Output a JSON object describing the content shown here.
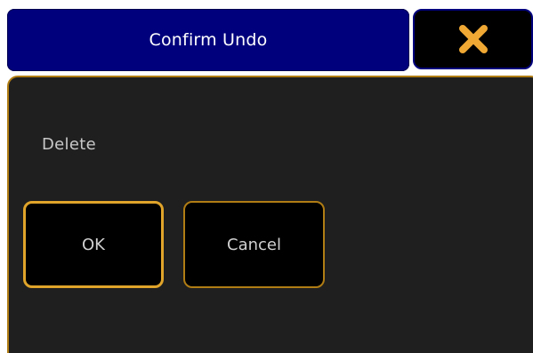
{
  "dialog": {
    "title": "Confirm Undo",
    "message": "Delete",
    "ok_label": "OK",
    "cancel_label": "Cancel",
    "close_icon": "close-x-icon"
  },
  "colors": {
    "title_bar": "#00007d",
    "accent": "#e0a42a",
    "panel_bg": "#1f1f1f",
    "panel_border": "#b07c14"
  }
}
